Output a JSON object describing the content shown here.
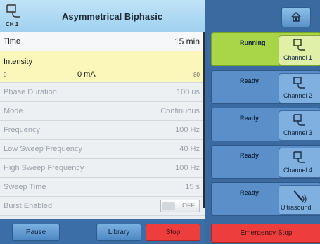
{
  "header": {
    "channel_label": "CH 1",
    "title": "Asymmetrical Biphasic"
  },
  "params": {
    "time": {
      "label": "Time",
      "value": "15 min"
    },
    "intensity": {
      "label": "Intensity",
      "min": "0",
      "current": "0 mA",
      "max": "80"
    },
    "rows": [
      {
        "label": "Phase Duration",
        "value": "100 us"
      },
      {
        "label": "Mode",
        "value": "Continuous"
      },
      {
        "label": "Frequency",
        "value": "100 Hz"
      },
      {
        "label": "Low Sweep Frequency",
        "value": "40 Hz"
      },
      {
        "label": "High Sweep Frequency",
        "value": "100 Hz"
      },
      {
        "label": "Sweep Time",
        "value": "15 s"
      }
    ],
    "burst": {
      "label": "Burst Enabled",
      "toggle": "OFF"
    }
  },
  "buttons": {
    "pause": "Pause",
    "library": "Library",
    "stop": "Stop"
  },
  "channels": [
    {
      "status": "Running",
      "name": "Channel 1",
      "icon": "electrode-icon"
    },
    {
      "status": "Ready",
      "name": "Channel 2",
      "icon": "electrode-icon"
    },
    {
      "status": "Ready",
      "name": "Channel 3",
      "icon": "electrode-icon"
    },
    {
      "status": "Ready",
      "name": "Channel 4",
      "icon": "electrode-icon"
    },
    {
      "status": "Ready",
      "extra": "-",
      "name": "Ultrasound",
      "icon": "ultrasound-icon"
    }
  ],
  "emergency": "Emergency Stop",
  "colors": {
    "header": "#a9d5f0",
    "intensity_bg": "#fbf6ba",
    "panel_blue": "#3a6aa0",
    "running": "#a8d648",
    "stop_red": "#ee3d3d"
  }
}
